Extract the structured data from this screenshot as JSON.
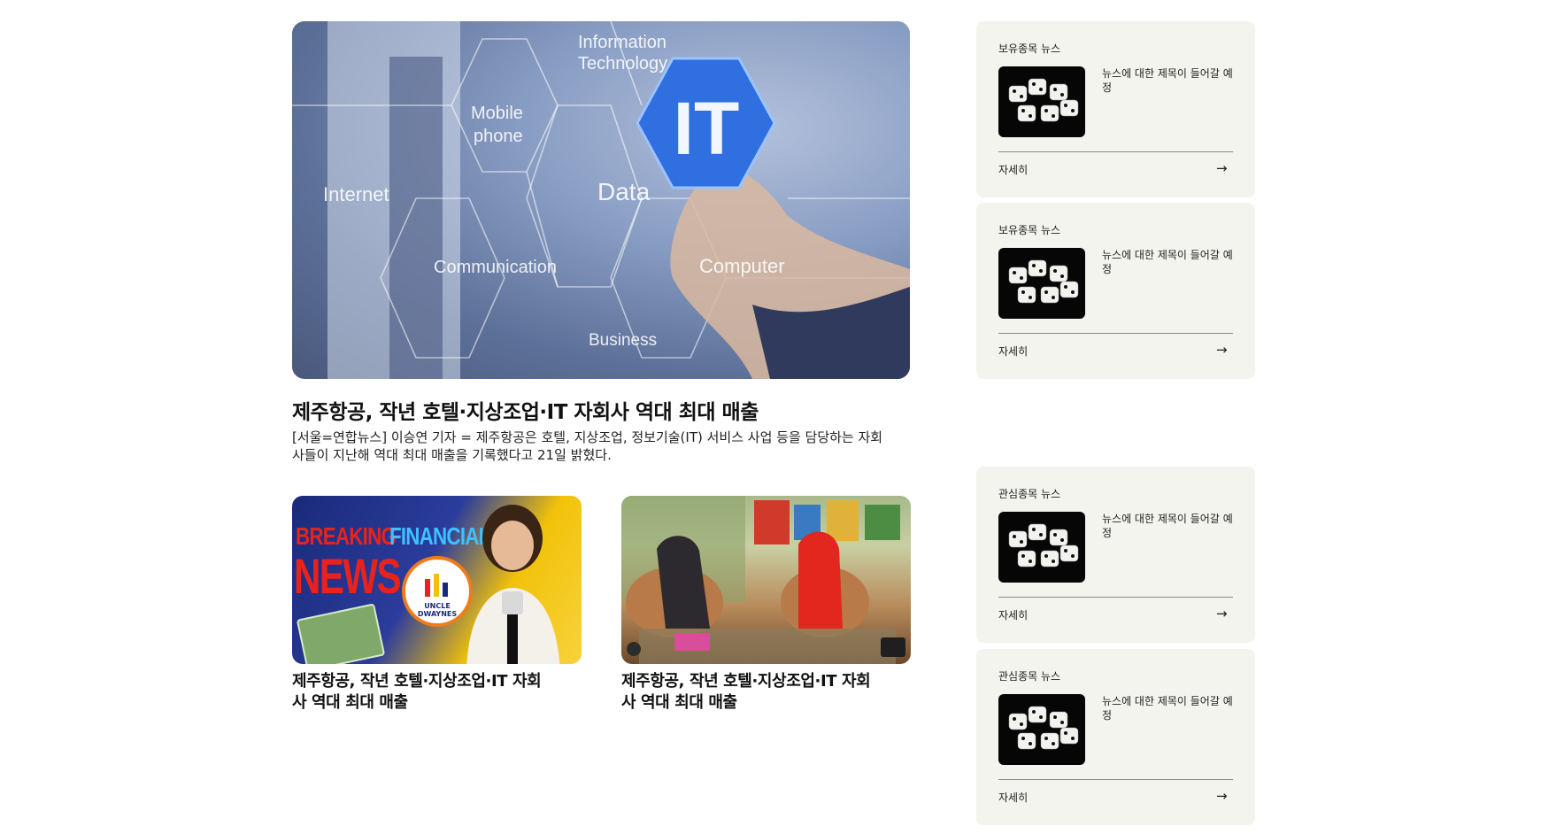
{
  "hero": {
    "title": "제주항공, 작년 호텔·지상조업·IT 자회사 역대 최대 매출",
    "summary": "[서울=연합뉴스] 이승연 기자 = 제주항공은 호텔, 지상조업, 정보기술(IT) 서비스 사업 등을 담당하는 자회사들이 지난해 역대 최대 매출을 기록했다고 21일 밝혔다.",
    "image_labels": {
      "center": "IT",
      "information": "Information",
      "technology": "Technology",
      "mobile": "Mobile",
      "phone": "phone",
      "data": "Data",
      "internet": "Internet",
      "communication": "Communication",
      "computer": "Computer",
      "business": "Business"
    }
  },
  "cards": [
    {
      "title": "제주항공, 작년 호텔·지상조업·IT 자회사 역대 최대 매출",
      "thumb_text": {
        "breaking": "BREAKING",
        "financial": "FINANCIAL",
        "news": "NEWS",
        "logo": "UNCLE DWAYNES"
      }
    },
    {
      "title": "제주항공, 작년 호텔·지상조업·IT 자회사 역대 최대 매출"
    }
  ],
  "panels": [
    {
      "label": "보유종목 뉴스",
      "text": "뉴스에 대한 제목이 들어갈 예정",
      "more": "자세히",
      "arrow": "→"
    },
    {
      "label": "보유종목 뉴스",
      "text": "뉴스에 대한 제목이 들어갈 예정",
      "more": "자세히",
      "arrow": "→"
    },
    {
      "label": "관심종목 뉴스",
      "text": "뉴스에 대한 제목이 들어갈 예정",
      "more": "자세히",
      "arrow": "→"
    },
    {
      "label": "관심종목 뉴스",
      "text": "뉴스에 대한 제목이 들어갈 예정",
      "more": "자세히",
      "arrow": "→"
    }
  ],
  "colors": {
    "panel_bg": "#f3f4ee",
    "it_hexagon": "#2f6fe0",
    "breaking_red": "#e8231c",
    "financial_blue": "#3fc0ff"
  }
}
